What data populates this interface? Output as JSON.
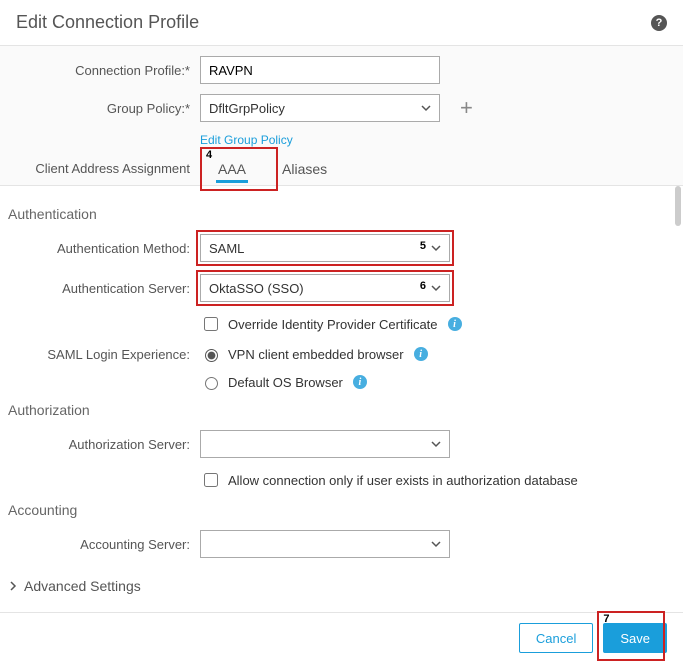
{
  "dialog": {
    "title": "Edit Connection Profile"
  },
  "top": {
    "connection_profile_label": "Connection Profile:*",
    "connection_profile_value": "RAVPN",
    "group_policy_label": "Group Policy:*",
    "group_policy_value": "DfltGrpPolicy",
    "edit_group_policy_link": "Edit Group Policy"
  },
  "tabs_area_label": "Client Address Assignment",
  "tabs": {
    "aaa": "AAA",
    "aliases": "Aliases"
  },
  "auth": {
    "section": "Authentication",
    "method_label": "Authentication Method:",
    "method_value": "SAML",
    "server_label": "Authentication Server:",
    "server_value": "OktaSSO (SSO)",
    "override_label": "Override Identity Provider Certificate",
    "login_exp_label": "SAML Login Experience:",
    "opt_embedded": "VPN client embedded browser",
    "opt_default_os": "Default OS Browser"
  },
  "authorization": {
    "section": "Authorization",
    "server_label": "Authorization Server:",
    "server_value": "",
    "allow_label": "Allow connection only if user exists in authorization database"
  },
  "accounting": {
    "section": "Accounting",
    "server_label": "Accounting Server:",
    "server_value": ""
  },
  "advanced_label": "Advanced Settings",
  "footer": {
    "cancel": "Cancel",
    "save": "Save"
  },
  "annotations": {
    "a4": "4",
    "a5": "5",
    "a6": "6",
    "a7": "7"
  }
}
